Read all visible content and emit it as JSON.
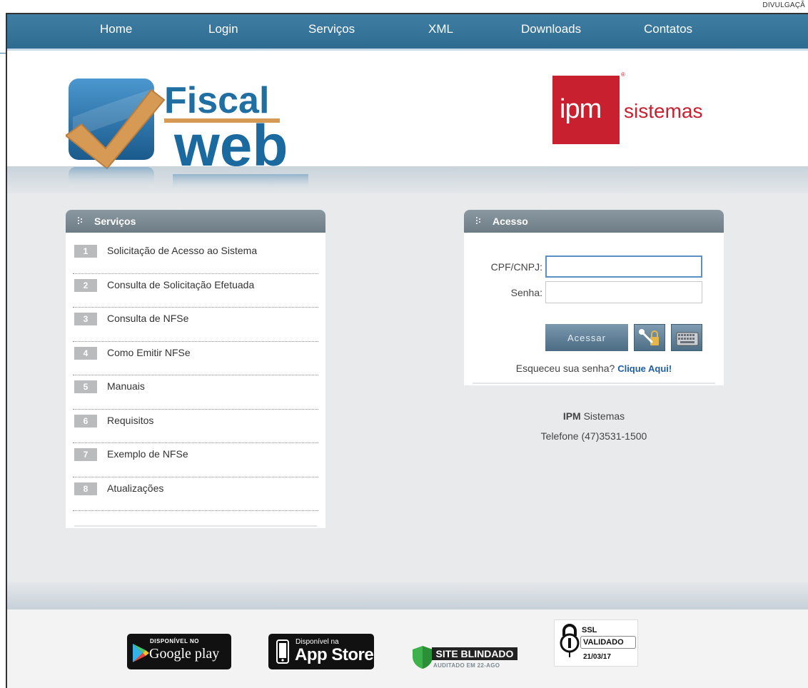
{
  "credit": "DIVULGAÇÃ",
  "nav": {
    "items": [
      "Home",
      "Login",
      "Serviços",
      "XML",
      "Downloads",
      "Contatos"
    ]
  },
  "header": {
    "logo_text_1": "Fiscal",
    "logo_text_2": "web",
    "ipm_mark": "ipm",
    "ipm_word": "sistemas"
  },
  "servicos": {
    "title": "Serviços",
    "items": [
      {
        "num": "1",
        "label": "Solicitação de Acesso ao Sistema"
      },
      {
        "num": "2",
        "label": "Consulta de Solicitação Efetuada"
      },
      {
        "num": "3",
        "label": "Consulta de NFSe"
      },
      {
        "num": "4",
        "label": "Como Emitir NFSe"
      },
      {
        "num": "5",
        "label": "Manuais"
      },
      {
        "num": "6",
        "label": "Requisitos"
      },
      {
        "num": "7",
        "label": "Exemplo de NFSe"
      },
      {
        "num": "8",
        "label": "Atualizações"
      }
    ]
  },
  "acesso": {
    "title": "Acesso",
    "cpf_label": "CPF/CNPJ:",
    "cpf_value": "",
    "senha_label": "Senha:",
    "senha_value": "",
    "button": "Acessar",
    "forgot_text": "Esqueceu sua senha?",
    "forgot_link": "Clique Aqui!"
  },
  "company": {
    "name_bold": "IPM",
    "name_rest": " Sistemas",
    "phone": "Telefone (47)3531-1500"
  },
  "footer": {
    "google_small": "DISPONÍVEL NO",
    "google_big": "Google play",
    "apple_small": "Disponível na",
    "apple_big": "App Store",
    "site_blindado": "SITE BLINDADO",
    "site_blindado_sub": "AUDITADO EM 22-AGO",
    "ssl_1": "SSL",
    "ssl_2": "VALIDADO",
    "ssl_date": "21/03/17"
  },
  "colors": {
    "nav": "#3a779d",
    "panel_head": "#7c8a94",
    "ipm_red": "#c8202f",
    "fiscal_blue": "#1e6a9e",
    "check_orange": "#d69a55"
  }
}
